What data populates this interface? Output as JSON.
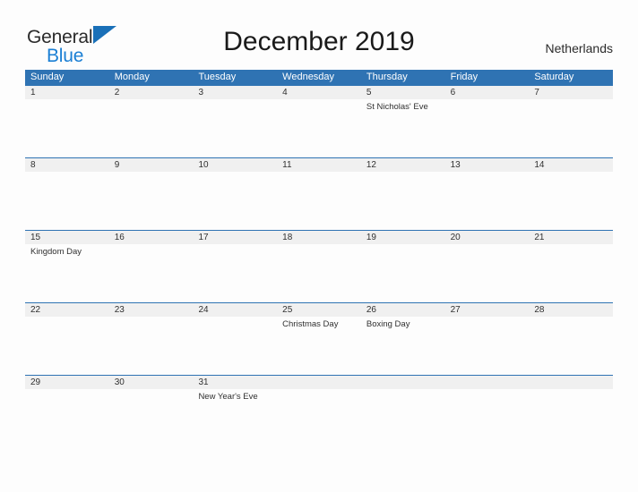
{
  "brand": {
    "line1": "General",
    "line2": "Blue",
    "flag_icon": "flag-triangle-icon",
    "accent_color": "#1a7fd4"
  },
  "header": {
    "title": "December 2019",
    "country": "Netherlands"
  },
  "colors": {
    "header_blue": "#2f73b3",
    "date_strip_gray": "#f0f0f0",
    "page_background": "#fdfdfd",
    "text_dark": "#303030"
  },
  "calendar": {
    "weekdays": [
      "Sunday",
      "Monday",
      "Tuesday",
      "Wednesday",
      "Thursday",
      "Friday",
      "Saturday"
    ],
    "weeks": [
      {
        "days": [
          {
            "date": "1",
            "event": ""
          },
          {
            "date": "2",
            "event": ""
          },
          {
            "date": "3",
            "event": ""
          },
          {
            "date": "4",
            "event": ""
          },
          {
            "date": "5",
            "event": "St Nicholas' Eve"
          },
          {
            "date": "6",
            "event": ""
          },
          {
            "date": "7",
            "event": ""
          }
        ]
      },
      {
        "days": [
          {
            "date": "8",
            "event": ""
          },
          {
            "date": "9",
            "event": ""
          },
          {
            "date": "10",
            "event": ""
          },
          {
            "date": "11",
            "event": ""
          },
          {
            "date": "12",
            "event": ""
          },
          {
            "date": "13",
            "event": ""
          },
          {
            "date": "14",
            "event": ""
          }
        ]
      },
      {
        "days": [
          {
            "date": "15",
            "event": "Kingdom Day"
          },
          {
            "date": "16",
            "event": ""
          },
          {
            "date": "17",
            "event": ""
          },
          {
            "date": "18",
            "event": ""
          },
          {
            "date": "19",
            "event": ""
          },
          {
            "date": "20",
            "event": ""
          },
          {
            "date": "21",
            "event": ""
          }
        ]
      },
      {
        "days": [
          {
            "date": "22",
            "event": ""
          },
          {
            "date": "23",
            "event": ""
          },
          {
            "date": "24",
            "event": ""
          },
          {
            "date": "25",
            "event": "Christmas Day"
          },
          {
            "date": "26",
            "event": "Boxing Day"
          },
          {
            "date": "27",
            "event": ""
          },
          {
            "date": "28",
            "event": ""
          }
        ]
      },
      {
        "days": [
          {
            "date": "29",
            "event": ""
          },
          {
            "date": "30",
            "event": ""
          },
          {
            "date": "31",
            "event": "New Year's Eve"
          },
          {
            "date": "",
            "event": ""
          },
          {
            "date": "",
            "event": ""
          },
          {
            "date": "",
            "event": ""
          },
          {
            "date": "",
            "event": ""
          }
        ]
      }
    ]
  }
}
